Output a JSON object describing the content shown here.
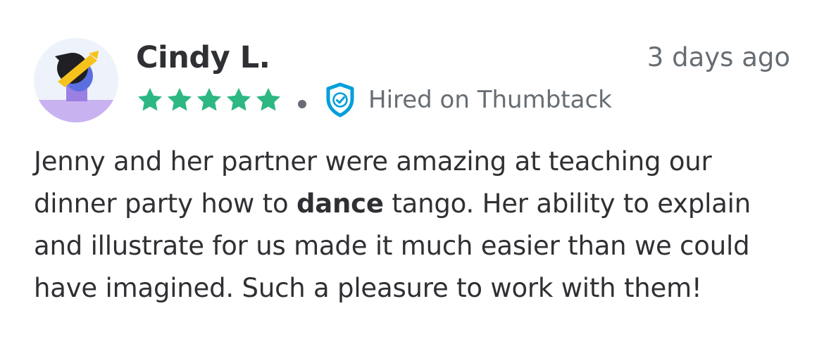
{
  "review": {
    "reviewer_name": "Cindy L.",
    "timestamp": "3 days ago",
    "rating": 5,
    "rating_max": 5,
    "star_color": "#2db783",
    "badge_text": "Hired on Thumbtack",
    "badge_icon": "shield-check-icon",
    "badge_color": "#009fd9",
    "body_parts": {
      "before": "Jenny and her partner were amazing at teaching our dinner party how to ",
      "highlight": "dance",
      "after": " tango. Her ability to explain and illustrate for us made it much easier than we could have imagined. Such a pleasure to work with them!"
    }
  }
}
